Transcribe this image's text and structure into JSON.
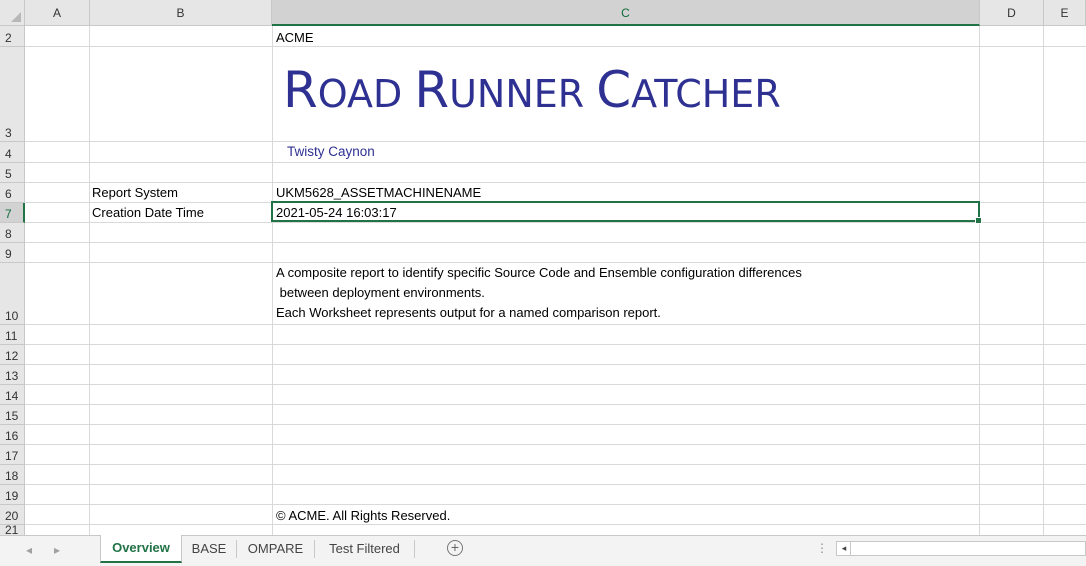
{
  "columns": [
    "A",
    "B",
    "C",
    "D",
    "E"
  ],
  "rows": [
    "2",
    "3",
    "4",
    "5",
    "6",
    "7",
    "8",
    "9",
    "10",
    "11",
    "12",
    "13",
    "14",
    "15",
    "16",
    "17",
    "18",
    "19",
    "20",
    "21"
  ],
  "selected_cell": "C7",
  "cells": {
    "c2": "ACME",
    "c3_title_parts": [
      "R",
      "OAD ",
      "R",
      "UNNER ",
      "C",
      "ATCHER"
    ],
    "c4": "Twisty Caynon",
    "b6": "Report System",
    "c6": "UKM5628_ASSETMACHINENAME",
    "b7": "Creation Date Time",
    "c7": "2021-05-24 16:03:17",
    "c10_line1": "A composite report to identify specific Source Code and Ensemble configuration differences",
    "c10_line2": " between deployment environments.",
    "c10_line3": "Each Worksheet represents output for a named comparison report.",
    "c20": "© ACME. All Rights Reserved."
  },
  "sheet_tabs": [
    {
      "label": "Overview",
      "active": true
    },
    {
      "label": "BASE",
      "active": false
    },
    {
      "label": "OMPARE",
      "active": false
    },
    {
      "label": "Test Filtered",
      "active": false
    }
  ],
  "icons": {
    "nav_prev": "◂",
    "nav_next": "▸",
    "add_sheet": "+",
    "more": "⋮",
    "scroll_left": "◂"
  },
  "colors": {
    "title": "#2e3192",
    "accent": "#217346"
  }
}
